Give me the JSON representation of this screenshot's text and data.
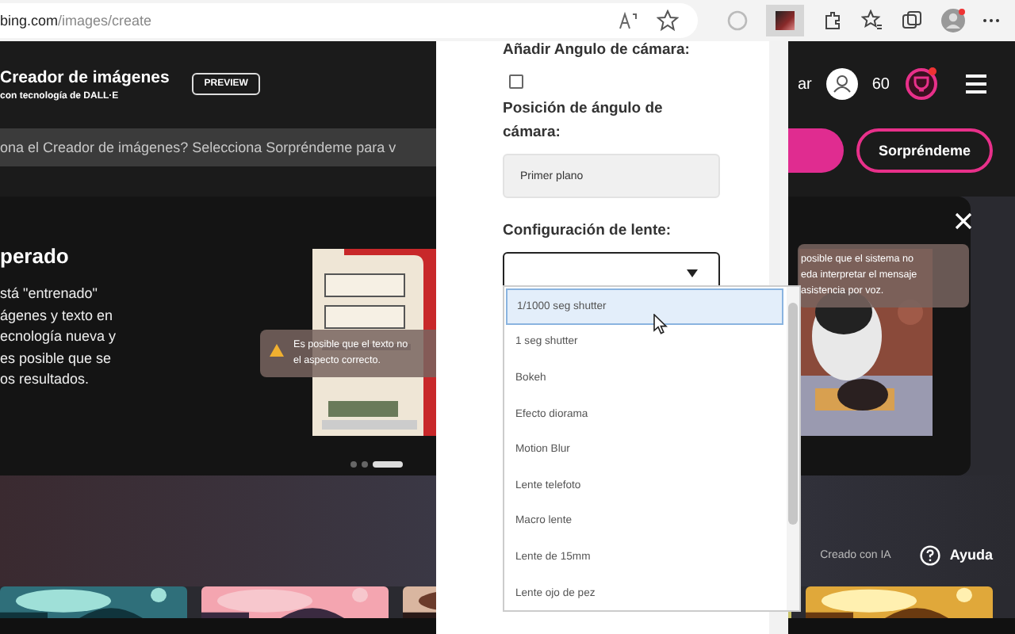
{
  "browser": {
    "url_host": "bing.com",
    "url_path": "/images/create"
  },
  "header": {
    "title": "Creador de imágenes",
    "subtitle": "con tecnología de DALL·E",
    "badge": "PREVIEW",
    "user_label": "ar",
    "points": "60",
    "notification": true
  },
  "search": {
    "placeholder": "ona el Creador de imágenes? Selecciona Sorpréndeme para v",
    "surprise_button": "Sorpréndeme"
  },
  "banner": {
    "heading": "perado",
    "body_lines": [
      "stá \"entrenado\"",
      "ágenes y texto en",
      "ecnología nueva y",
      "es posible que se",
      "os resultados."
    ],
    "tooltips": [
      {
        "kind": "warning",
        "lines": [
          "Es posible que el texto no",
          "el aspecto correcto."
        ]
      },
      {
        "kind": "info",
        "lines": [
          "posible que el sistema no",
          "eda interpretar el mensaje",
          "asistencia por voz."
        ]
      }
    ],
    "dots": [
      {
        "selected": false
      },
      {
        "selected": false
      },
      {
        "selected": true
      }
    ]
  },
  "footer": {
    "created": "Creado con IA",
    "help": "Ayuda"
  },
  "popup": {
    "camera_angle_label": "Añadir Angulo de cámara:",
    "camera_angle_checked": false,
    "position_label": "Posición de ángulo de cámara:",
    "position_value": "Primer plano",
    "lens_label": "Configuración de lente:",
    "lens_options": [
      {
        "label": "1/1000 seg shutter",
        "selected": true
      },
      {
        "label": "1 seg shutter",
        "selected": false
      },
      {
        "label": "Bokeh",
        "selected": false
      },
      {
        "label": "Efecto diorama",
        "selected": false
      },
      {
        "label": "Motion Blur",
        "selected": false
      },
      {
        "label": "Lente telefoto",
        "selected": false
      },
      {
        "label": "Macro lente",
        "selected": false
      },
      {
        "label": "Lente de 15mm",
        "selected": false
      },
      {
        "label": "Lente ojo de pez",
        "selected": false
      }
    ]
  }
}
